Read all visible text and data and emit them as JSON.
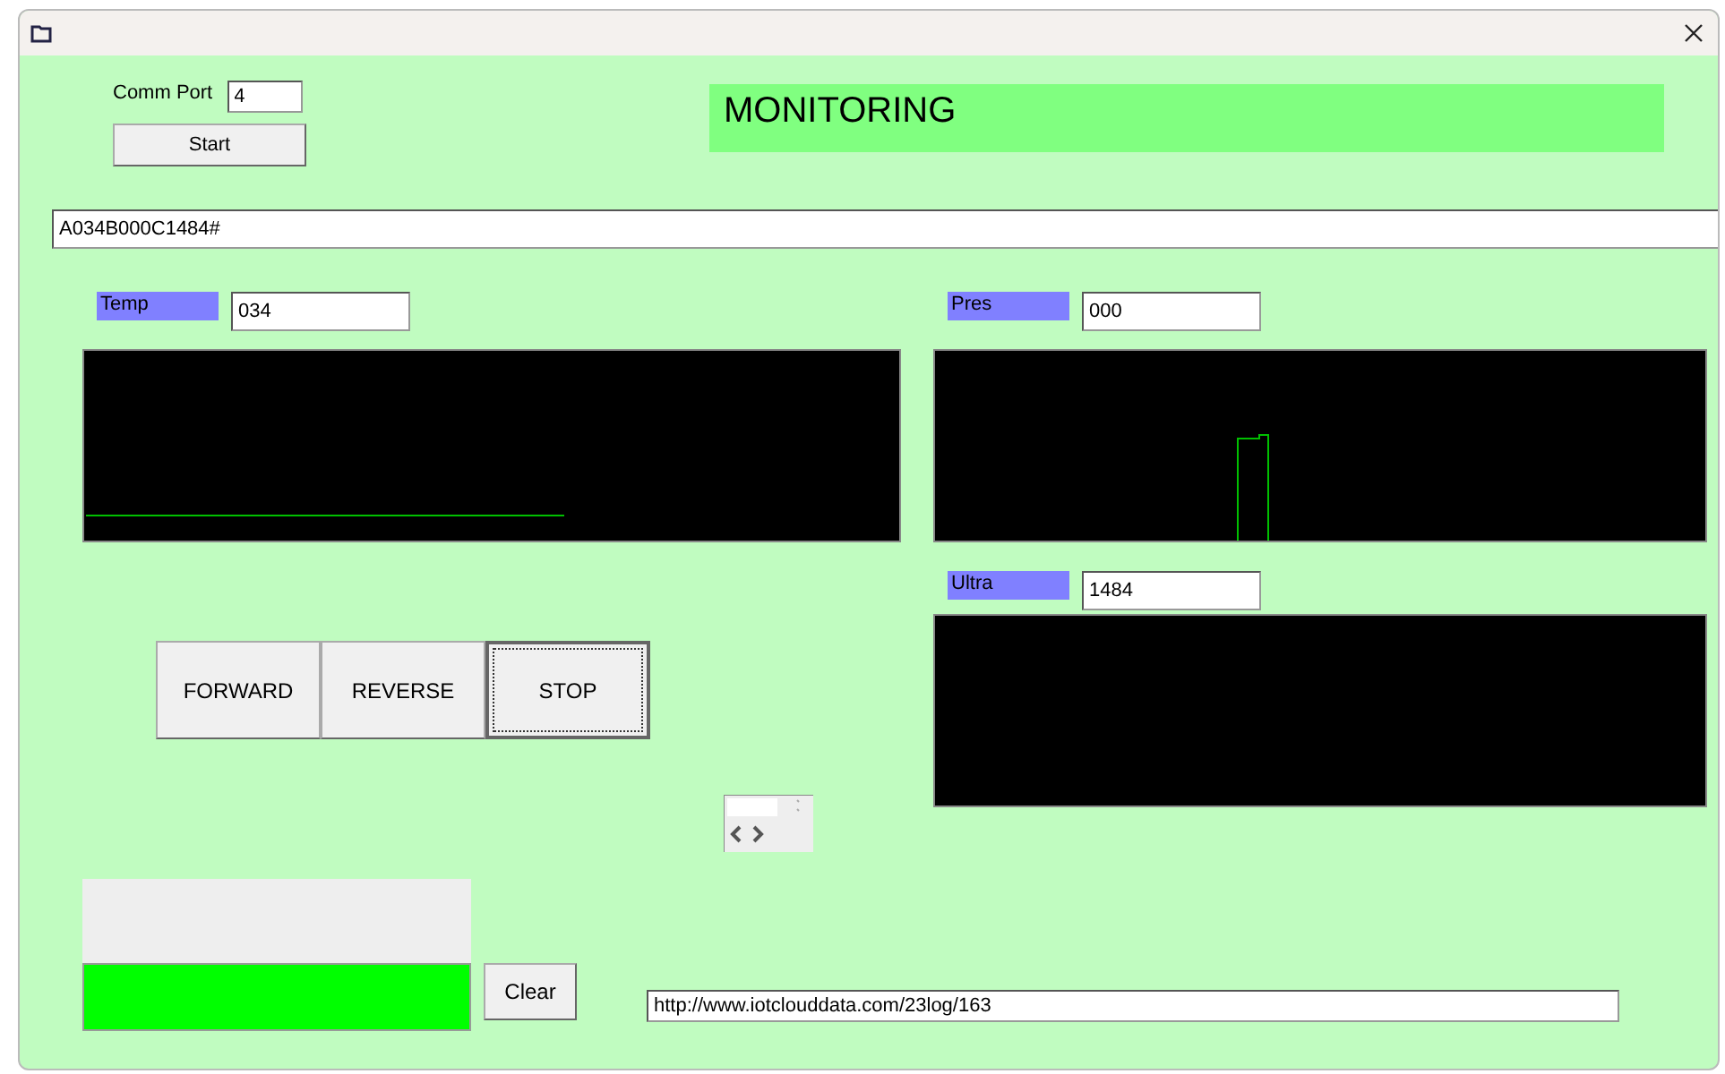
{
  "comm_port": {
    "label": "Comm Port",
    "value": "4"
  },
  "start_button": {
    "label": "Start"
  },
  "banner": {
    "title": "MONITORING"
  },
  "data_field": {
    "value": "A034B000C1484#"
  },
  "sensors": [
    {
      "label": "Temp",
      "value": "034"
    },
    {
      "label": "Pres",
      "value": "000"
    },
    {
      "label": "Ultra",
      "value": "1484"
    }
  ],
  "motor_buttons": [
    {
      "label": "FORWARD",
      "focused": false
    },
    {
      "label": "REVERSE",
      "focused": false
    },
    {
      "label": "STOP",
      "focused": true
    }
  ],
  "clear_button": {
    "label": "Clear"
  },
  "url_field": {
    "value": "http://www.iotclouddata.com/23log/163"
  }
}
